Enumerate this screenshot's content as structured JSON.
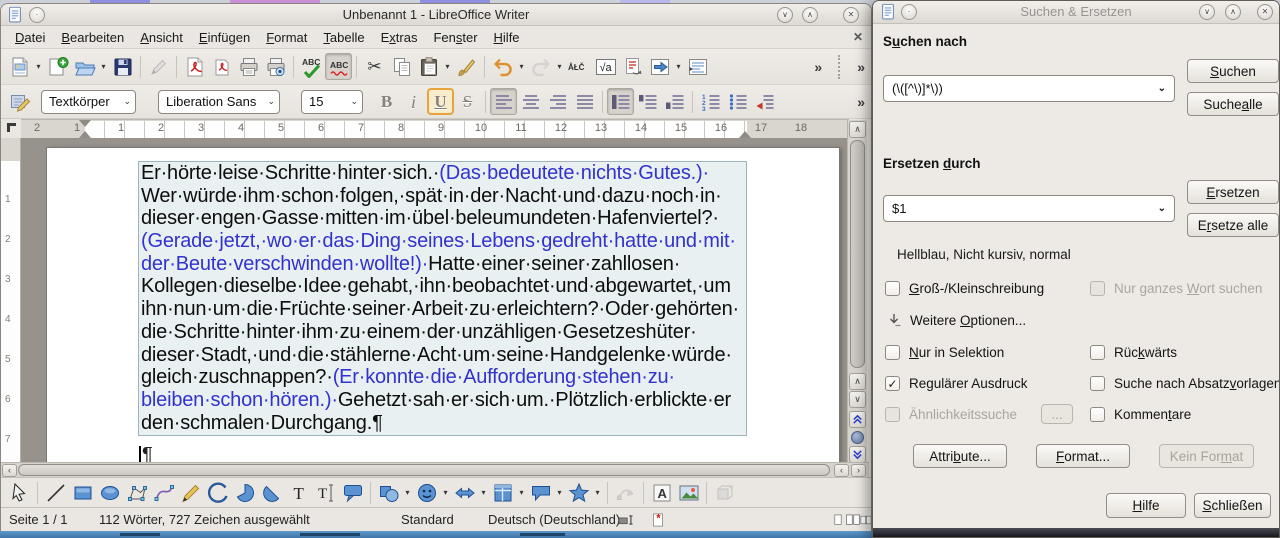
{
  "main_window": {
    "title": "Unbenannt 1 - LibreOffice Writer",
    "menu": [
      {
        "label": "Datei",
        "u": 0,
        "name": "menu-datei"
      },
      {
        "label": "Bearbeiten",
        "u": 0,
        "name": "menu-bearbeiten"
      },
      {
        "label": "Ansicht",
        "u": 0,
        "name": "menu-ansicht"
      },
      {
        "label": "Einfügen",
        "u": 0,
        "name": "menu-einfuegen"
      },
      {
        "label": "Format",
        "u": 0,
        "name": "menu-format"
      },
      {
        "label": "Tabelle",
        "u": 0,
        "name": "menu-tabelle"
      },
      {
        "label": "Extras",
        "u": 1,
        "name": "menu-extras"
      },
      {
        "label": "Fenster",
        "u": 3,
        "name": "menu-fenster"
      },
      {
        "label": "Hilfe",
        "u": 0,
        "name": "menu-hilfe"
      }
    ],
    "toolbar_standard": [
      {
        "name": "new-document",
        "dropdown": true
      },
      {
        "name": "new-from-template"
      },
      {
        "name": "open",
        "dropdown": true
      },
      {
        "name": "save"
      },
      "|",
      {
        "name": "edit-mode",
        "disabled": true
      },
      "|",
      {
        "name": "export-pdf"
      },
      {
        "name": "export-pdf-direct"
      },
      {
        "name": "print"
      },
      {
        "name": "print-preview"
      },
      "|",
      {
        "name": "spelling"
      },
      {
        "name": "auto-spellcheck",
        "pressed": true
      },
      "|",
      {
        "name": "cut"
      },
      {
        "name": "copy"
      },
      {
        "name": "paste",
        "dropdown": true
      },
      {
        "name": "clone-formatting"
      },
      "|",
      {
        "name": "undo",
        "dropdown": true
      },
      {
        "name": "redo",
        "disabled": true,
        "dropdown": true
      },
      {
        "name": "special-character"
      },
      {
        "name": "insert-formula"
      },
      {
        "name": "track-changes"
      },
      {
        "name": "navigator",
        "dropdown": true
      },
      {
        "name": "formatting-marks"
      }
    ],
    "formatting": {
      "paragraph_style": "Textkörper",
      "font_name": "Liberation Sans",
      "font_size": "15",
      "toolbar": [
        {
          "name": "bold"
        },
        {
          "name": "italic"
        },
        {
          "name": "underline",
          "accent": true
        },
        {
          "name": "strikethrough"
        },
        "|",
        {
          "name": "align-left",
          "pressed": true
        },
        {
          "name": "align-center"
        },
        {
          "name": "align-right"
        },
        {
          "name": "justify"
        },
        "|",
        {
          "name": "spacing-1",
          "pressed": true
        },
        {
          "name": "spacing-2"
        },
        {
          "name": "spacing-3"
        },
        "|",
        {
          "name": "ordered-list"
        },
        {
          "name": "unordered-list"
        },
        {
          "name": "no-list"
        }
      ]
    },
    "toolbar_drawing": [
      {
        "name": "select"
      },
      "|",
      {
        "name": "insert-line"
      },
      {
        "name": "rectangle"
      },
      {
        "name": "ellipse"
      },
      {
        "name": "polygon"
      },
      {
        "name": "curve"
      },
      {
        "name": "freeform-line"
      },
      {
        "name": "arc"
      },
      {
        "name": "ellipse-pie"
      },
      {
        "name": "circle-segment"
      },
      {
        "name": "text-box"
      },
      {
        "name": "vertical-text"
      },
      {
        "name": "callout"
      },
      "|",
      {
        "name": "basic-shapes",
        "dropdown": true
      },
      {
        "name": "symbol-shapes",
        "dropdown": true
      },
      {
        "name": "block-arrows",
        "dropdown": true
      },
      {
        "name": "flowchart",
        "dropdown": true
      },
      {
        "name": "callout-shapes",
        "dropdown": true
      },
      {
        "name": "star-shapes",
        "dropdown": true
      },
      "|",
      {
        "name": "edit-points",
        "disabled": true
      },
      "|",
      {
        "name": "fontwork"
      },
      {
        "name": "insert-image"
      },
      "|",
      {
        "name": "extrusion",
        "disabled": true
      }
    ],
    "ruler": {
      "h_left_gray": [
        "2",
        "1"
      ],
      "h_main": [
        "1",
        "2",
        "3",
        "4",
        "5",
        "6",
        "7",
        "8",
        "9",
        "10",
        "11",
        "12",
        "13",
        "14",
        "15",
        "16",
        "17",
        "18"
      ],
      "v_main": [
        "1",
        "2",
        "3",
        "4",
        "5",
        "6",
        "7"
      ]
    },
    "status_bar": {
      "page": "Seite 1 / 1",
      "words": "112 Wörter, 727 Zeichen ausgewählt",
      "style": "Standard",
      "language": "Deutsch (Deutschland)"
    }
  },
  "document": {
    "lines": [
      [
        {
          "t": "Er·hörte·leise·Schritte·hinter·sich.·",
          "c": "k"
        },
        {
          "t": "(Das·bedeutete·nichts·Gutes.)·",
          "c": "b"
        }
      ],
      [
        {
          "t": "Wer·würde·ihm·schon·folgen,·spät·in·der·Nacht·und·dazu·noch·in·",
          "c": "k"
        }
      ],
      [
        {
          "t": "dieser·engen·Gasse·mitten·im·übel·beleumundeten·Hafenviertel?·",
          "c": "k"
        }
      ],
      [
        {
          "t": "(Gerade·jetzt,·wo·er·das·Ding·seines·Lebens·gedreht·hatte·und·mit·",
          "c": "b"
        }
      ],
      [
        {
          "t": "der·Beute·verschwinden·wollte!)·",
          "c": "b"
        },
        {
          "t": "Hatte·einer·seiner·zahllosen·",
          "c": "k"
        }
      ],
      [
        {
          "t": "Kollegen·dieselbe·Idee·gehabt,·ihn·beobachtet·und·abgewartet,·um",
          "c": "k"
        }
      ],
      [
        {
          "t": "ihn·nun·um·die·Früchte·seiner·Arbeit·zu·erleichtern?·Oder·gehörten·",
          "c": "k"
        }
      ],
      [
        {
          "t": "die·Schritte·hinter·ihm·zu·einem·der·unzähligen·Gesetzeshüter·",
          "c": "k"
        }
      ],
      [
        {
          "t": "dieser·Stadt,·und·die·stählerne·Acht·um·seine·Handgelenke·würde·",
          "c": "k"
        }
      ],
      [
        {
          "t": "gleich·zuschnappen?·",
          "c": "k"
        },
        {
          "t": "(Er·konnte·die·Aufforderung·stehen·zu·",
          "c": "b"
        }
      ],
      [
        {
          "t": "bleiben·schon·hören.)·",
          "c": "b"
        },
        {
          "t": "Gehetzt·sah·er·sich·um.·Plötzlich·erblickte·er",
          "c": "k"
        }
      ],
      [
        {
          "t": "den·schmalen·Durchgang.¶",
          "c": "k"
        }
      ]
    ],
    "empty_mark": "¶"
  },
  "dialog": {
    "title": "Suchen & Ersetzen",
    "search_label": {
      "label": "Suchen nach",
      "u": 1
    },
    "search_value": "(\\([^\\)]*\\))",
    "replace_label": {
      "label": "Ersetzen durch",
      "u": 9
    },
    "replace_value": "$1",
    "replace_format_note": "Hellblau, Nicht kursiv, normal",
    "expander": {
      "label": "Weitere Optionen...",
      "u": 8
    },
    "buttons": {
      "search": {
        "label": "Suchen",
        "u": 0
      },
      "find_all": {
        "label": "Suche alle",
        "u": 6
      },
      "replace": {
        "label": "Ersetzen",
        "u": 0
      },
      "replace_all": {
        "label": "Ersetze alle",
        "u": 1
      },
      "attributes": {
        "label": "Attribute...",
        "u": 5
      },
      "format": {
        "label": "Format...",
        "u": 0
      },
      "no_format": {
        "label": "Kein Format",
        "u": 8,
        "disabled": true
      },
      "similarity_settings": {
        "label": "...",
        "disabled": true
      },
      "help": {
        "label": "Hilfe",
        "u": 0
      },
      "close": {
        "label": "Schließen",
        "u": 0
      }
    },
    "options": [
      {
        "name": "case-sensitive",
        "label": "Groß-/Kleinschreibung",
        "u": 0,
        "checked": false,
        "disabled": false,
        "col": 1,
        "row": 1
      },
      {
        "name": "whole-words-only",
        "label": "Nur ganzes Wort suchen",
        "u": 11,
        "checked": false,
        "disabled": true,
        "col": 2,
        "row": 1
      },
      {
        "name": "selection-only",
        "label": "Nur in Selektion",
        "u": 0,
        "checked": false,
        "disabled": false,
        "col": 1,
        "row": 2
      },
      {
        "name": "backwards",
        "label": "Rückwärts",
        "u": 3,
        "checked": false,
        "disabled": false,
        "col": 2,
        "row": 2
      },
      {
        "name": "regular-expressions",
        "label": "Regulärer Ausdruck",
        "checked": true,
        "disabled": false,
        "col": 1,
        "row": 3
      },
      {
        "name": "paragraph-styles",
        "label": "Suche nach Absatzvorlagen",
        "u": 17,
        "checked": false,
        "disabled": false,
        "col": 2,
        "row": 3
      },
      {
        "name": "similarity-search",
        "label": "Ähnlichkeitssuche",
        "checked": false,
        "disabled": true,
        "col": 1,
        "row": 4
      },
      {
        "name": "comments",
        "label": "Kommentare",
        "u": 6,
        "checked": false,
        "disabled": false,
        "col": 2,
        "row": 4
      }
    ]
  }
}
